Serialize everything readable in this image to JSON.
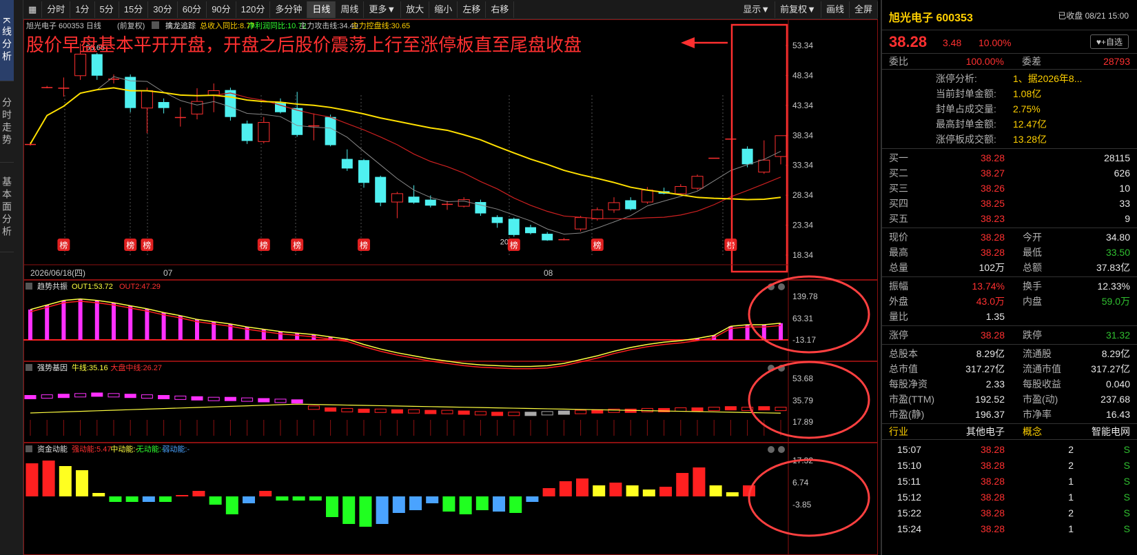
{
  "left_tabs": [
    "K线分析",
    "分时走势",
    "基本面分析"
  ],
  "toolbar": {
    "periods": [
      "分时",
      "1分",
      "5分",
      "15分",
      "30分",
      "60分",
      "90分",
      "120分",
      "多分钟",
      "日线",
      "周线",
      "更多▼",
      "放大",
      "缩小",
      "左移",
      "右移"
    ],
    "active": "日线",
    "right": [
      "显示▼",
      "前复权▼",
      "画线",
      "全屏"
    ]
  },
  "main_panel": {
    "header_name": "旭光电子 600353 日线",
    "header_fq": "(前复权)",
    "ind_name": "擒龙追踪",
    "ind_items": [
      {
        "text": "总收入同比:8.77",
        "color": "#ffd000"
      },
      {
        "text": "净利润同比:10.72",
        "color": "#30ff30"
      },
      {
        "text": "主力攻击线:34.49",
        "color": "#c8c8c8"
      },
      {
        "text": "主力控盘线:30.65",
        "color": "#ffd000"
      }
    ],
    "annotation": "股价早盘基本平开开盘，开盘之后股价震荡上行至涨停板直至尾盘收盘",
    "y_labels": [
      "53.34",
      "48.34",
      "43.34",
      "38.34",
      "33.34",
      "28.34",
      "23.34",
      "18.34"
    ],
    "high_label": "53.66",
    "low_label": "20.72",
    "date_left": "2026/06/18(四)",
    "month_labels": [
      "07",
      "08"
    ],
    "bang_label": "榜"
  },
  "sub_panels": [
    {
      "name": "趋势共振",
      "items": [
        {
          "text": "OUT1:53.72",
          "color": "#ffff40"
        },
        {
          "text": "OUT2:47.29",
          "color": "#ff3030"
        }
      ],
      "y_labels": [
        "139.78",
        "63.31",
        "-13.17"
      ]
    },
    {
      "name": "强势基因",
      "items": [
        {
          "text": "牛线:35.16",
          "color": "#ffff40"
        },
        {
          "text": "大盘中线:26.27",
          "color": "#ff3030"
        }
      ],
      "y_labels": [
        "53.68",
        "35.79",
        "17.89"
      ]
    },
    {
      "name": "资金动能",
      "items": [
        {
          "text": "强动能:5.47",
          "color": "#ff3030"
        },
        {
          "text": "中动能:-",
          "color": "#ffff40"
        },
        {
          "text": "无动能:-",
          "color": "#30ff30"
        },
        {
          "text": "弱动能:-",
          "color": "#4aa3ff"
        }
      ],
      "y_labels": [
        "17.32",
        "6.74",
        "-3.85"
      ]
    }
  ],
  "chart_data": {
    "type": "candlestick",
    "title": "旭光电子 600353 日线",
    "y_range": [
      18.34,
      53.34
    ],
    "candles": [
      {
        "o": 36.9,
        "c": 36.9,
        "h": 37.2,
        "l": 36.6
      },
      {
        "o": 46.4,
        "c": 46.4,
        "h": 46.6,
        "l": 46.2
      },
      {
        "o": 46.3,
        "c": 46.3,
        "h": 48.0,
        "l": 44.8
      },
      {
        "o": 48.3,
        "c": 51.9,
        "h": 53.66,
        "l": 47.6
      },
      {
        "o": 51.9,
        "c": 48.3,
        "h": 52.1,
        "l": 47.6
      },
      {
        "o": 47.8,
        "c": 47.8,
        "h": 48.5,
        "l": 47.0
      },
      {
        "o": 48.1,
        "c": 42.9,
        "h": 48.5,
        "l": 42.2
      },
      {
        "o": 42.9,
        "c": 45.8,
        "h": 46.3,
        "l": 38.7
      },
      {
        "o": 43.9,
        "c": 42.9,
        "h": 44.5,
        "l": 42.0
      },
      {
        "o": 41.4,
        "c": 41.4,
        "h": 43.0,
        "l": 39.8
      },
      {
        "o": 41.9,
        "c": 44.0,
        "h": 46.2,
        "l": 41.0
      },
      {
        "o": 45.0,
        "c": 45.8,
        "h": 47.0,
        "l": 42.2
      },
      {
        "o": 45.9,
        "c": 41.4,
        "h": 46.3,
        "l": 40.8
      },
      {
        "o": 40.3,
        "c": 37.4,
        "h": 40.8,
        "l": 36.9
      },
      {
        "o": 37.3,
        "c": 40.5,
        "h": 41.4,
        "l": 37.0
      },
      {
        "o": 43.9,
        "c": 42.2,
        "h": 44.5,
        "l": 42.0
      },
      {
        "o": 42.9,
        "c": 38.4,
        "h": 45.6,
        "l": 38.1
      },
      {
        "o": 40.0,
        "c": 40.0,
        "h": 42.0,
        "l": 37.5
      },
      {
        "o": 41.4,
        "c": 36.7,
        "h": 41.8,
        "l": 36.5
      },
      {
        "o": 34.4,
        "c": 32.8,
        "h": 36.0,
        "l": 32.4
      },
      {
        "o": 34.2,
        "c": 30.4,
        "h": 34.4,
        "l": 29.6
      },
      {
        "o": 31.4,
        "c": 27.1,
        "h": 31.6,
        "l": 26.5
      },
      {
        "o": 27.2,
        "c": 28.6,
        "h": 28.9,
        "l": 24.5
      },
      {
        "o": 28.1,
        "c": 27.1,
        "h": 30.0,
        "l": 26.9
      },
      {
        "o": 27.6,
        "c": 26.6,
        "h": 28.3,
        "l": 26.3
      },
      {
        "o": 26.9,
        "c": 26.9,
        "h": 27.4,
        "l": 25.9
      },
      {
        "o": 26.5,
        "c": 27.6,
        "h": 28.0,
        "l": 26.3
      },
      {
        "o": 27.2,
        "c": 25.3,
        "h": 27.6,
        "l": 24.9
      },
      {
        "o": 24.7,
        "c": 23.7,
        "h": 25.0,
        "l": 22.9
      },
      {
        "o": 24.4,
        "c": 21.7,
        "h": 24.6,
        "l": 21.4
      },
      {
        "o": 23.0,
        "c": 22.0,
        "h": 23.4,
        "l": 21.8
      },
      {
        "o": 21.9,
        "c": 20.8,
        "h": 22.2,
        "l": 20.72
      },
      {
        "o": 21.0,
        "c": 21.0,
        "h": 21.2,
        "l": 20.8
      },
      {
        "o": 22.7,
        "c": 24.6,
        "h": 24.9,
        "l": 22.3
      },
      {
        "o": 24.4,
        "c": 25.9,
        "h": 26.3,
        "l": 24.1
      },
      {
        "o": 25.9,
        "c": 27.1,
        "h": 28.0,
        "l": 25.4
      },
      {
        "o": 27.5,
        "c": 26.0,
        "h": 28.0,
        "l": 25.8
      },
      {
        "o": 27.2,
        "c": 29.2,
        "h": 29.7,
        "l": 26.9
      },
      {
        "o": 29.0,
        "c": 28.6,
        "h": 29.6,
        "l": 28.5
      },
      {
        "o": 28.6,
        "c": 29.8,
        "h": 30.2,
        "l": 28.5
      },
      {
        "o": 29.5,
        "c": 31.5,
        "h": 31.8,
        "l": 29.2
      },
      {
        "o": 34.6,
        "c": 34.6,
        "h": 34.6,
        "l": 34.6
      },
      {
        "o": 37.8,
        "c": 37.8,
        "h": 37.8,
        "l": 37.8
      },
      {
        "o": 36.1,
        "c": 33.5,
        "h": 36.5,
        "l": 33.0
      },
      {
        "o": 32.2,
        "c": 34.2,
        "h": 37.5,
        "l": 31.9
      },
      {
        "o": 34.8,
        "c": 38.28,
        "h": 38.28,
        "l": 33.5
      }
    ]
  },
  "right_panel": {
    "title": "旭光电子 600353",
    "status": "已收盘 08/21 15:00",
    "price": "38.28",
    "change": "3.48",
    "change_pct": "10.00%",
    "add_btn": "♥+自选",
    "weibi_label": "委比",
    "weibi": "100.00%",
    "weicha_label": "委差",
    "weicha": "28793",
    "limit_info": [
      {
        "k": "涨停分析:",
        "v": "1、据2026年8..."
      },
      {
        "k": "当前封单金额:",
        "v": "1.08亿"
      },
      {
        "k": "封单占成交量:",
        "v": "2.75%"
      },
      {
        "k": "最高封单金额:",
        "v": "12.47亿"
      },
      {
        "k": "涨停板成交额:",
        "v": "13.28亿"
      }
    ],
    "bids": [
      {
        "label": "买一",
        "price": "38.28",
        "vol": "28115"
      },
      {
        "label": "买二",
        "price": "38.27",
        "vol": "626"
      },
      {
        "label": "买三",
        "price": "38.26",
        "vol": "10"
      },
      {
        "label": "买四",
        "price": "38.25",
        "vol": "33"
      },
      {
        "label": "买五",
        "price": "38.23",
        "vol": "9"
      }
    ],
    "quote": [
      {
        "k1": "现价",
        "v1": "38.28",
        "c1": "red",
        "k2": "今开",
        "v2": "34.80",
        "c2": "wht"
      },
      {
        "k1": "最高",
        "v1": "38.28",
        "c1": "red",
        "k2": "最低",
        "v2": "33.50",
        "c2": "green"
      },
      {
        "k1": "总量",
        "v1": "102万",
        "c1": "wht",
        "k2": "总额",
        "v2": "37.83亿",
        "c2": "wht"
      }
    ],
    "quote2": [
      {
        "k1": "振幅",
        "v1": "13.74%",
        "c1": "red",
        "k2": "换手",
        "v2": "12.33%",
        "c2": "wht"
      },
      {
        "k1": "外盘",
        "v1": "43.0万",
        "c1": "red",
        "k2": "内盘",
        "v2": "59.0万",
        "c2": "green"
      },
      {
        "k1": "量比",
        "v1": "1.35",
        "c1": "wht",
        "k2": "",
        "v2": "",
        "c2": "wht"
      }
    ],
    "quote3": [
      {
        "k1": "涨停",
        "v1": "38.28",
        "c1": "red",
        "k2": "跌停",
        "v2": "31.32",
        "c2": "green"
      }
    ],
    "fundamentals": [
      {
        "k1": "总股本",
        "v1": "8.29亿",
        "k2": "流通股",
        "v2": "8.29亿"
      },
      {
        "k1": "总市值",
        "v1": "317.27亿",
        "k2": "流通市值",
        "v2": "317.27亿"
      },
      {
        "k1": "每股净资",
        "v1": "2.33",
        "k2": "每股收益",
        "v2": "0.040"
      },
      {
        "k1": "市盈(TTM)",
        "v1": "192.52",
        "k2": "市盈(动)",
        "v2": "237.68"
      },
      {
        "k1": "市盈(静)",
        "v1": "196.37",
        "k2": "市净率",
        "v2": "16.43"
      }
    ],
    "industry": {
      "k1": "行业",
      "v1": "其他电子",
      "k2": "概念",
      "v2": "智能电网"
    },
    "ticks": [
      {
        "t": "15:07",
        "p": "38.28",
        "v": "2",
        "s": "S"
      },
      {
        "t": "15:10",
        "p": "38.28",
        "v": "2",
        "s": "S"
      },
      {
        "t": "15:11",
        "p": "38.28",
        "v": "1",
        "s": "S"
      },
      {
        "t": "15:12",
        "p": "38.28",
        "v": "1",
        "s": "S"
      },
      {
        "t": "15:22",
        "p": "38.28",
        "v": "2",
        "s": "S"
      },
      {
        "t": "15:24",
        "p": "38.28",
        "v": "1",
        "s": "S"
      }
    ]
  }
}
